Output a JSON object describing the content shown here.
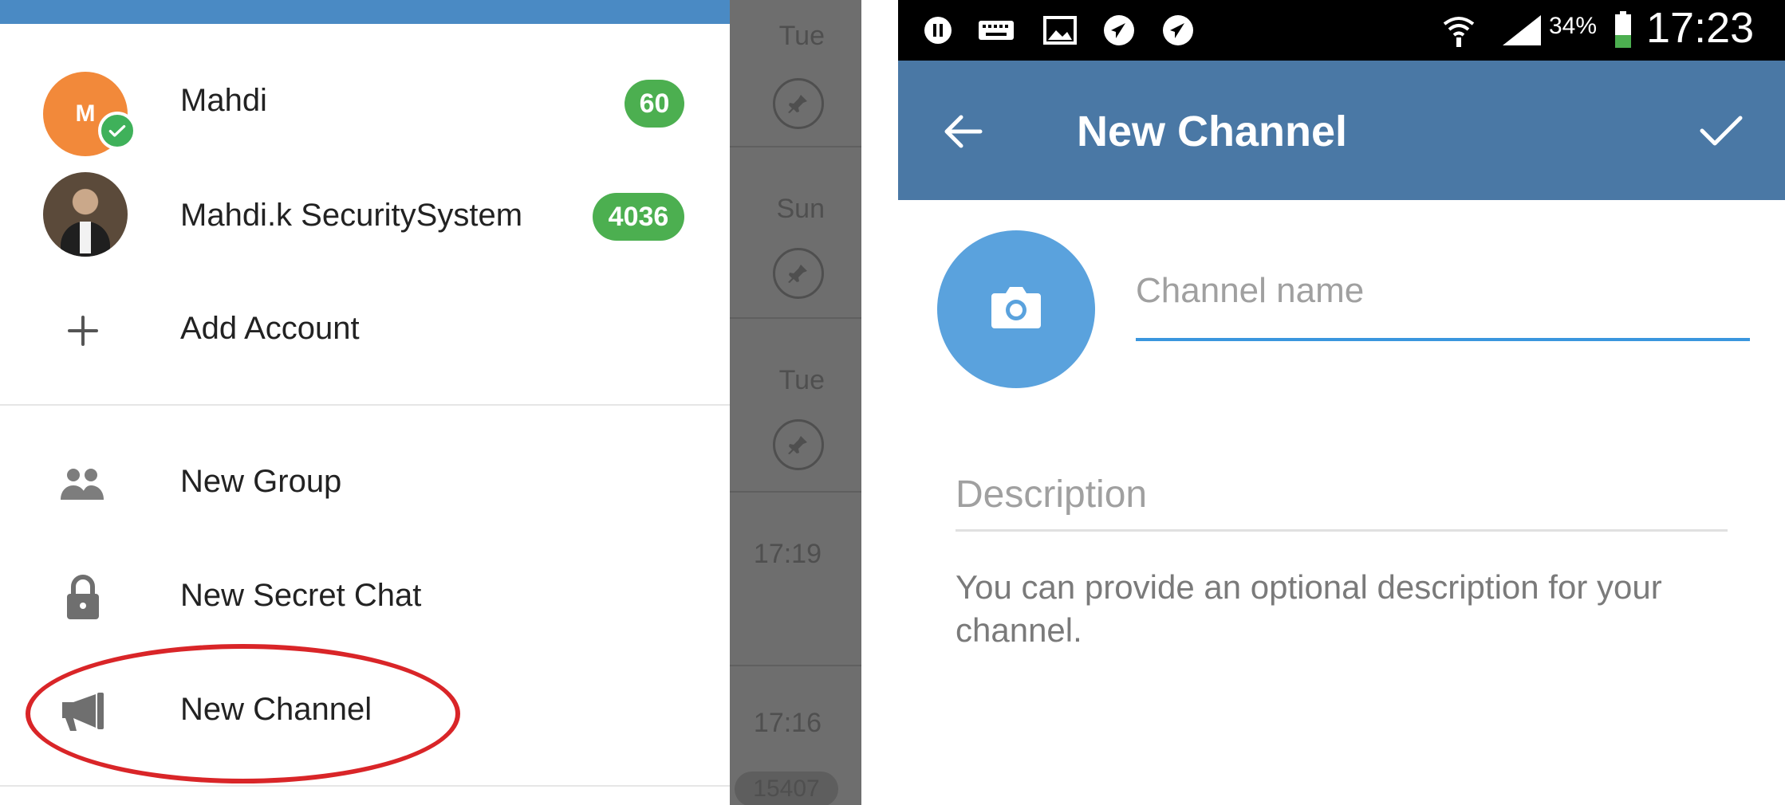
{
  "left": {
    "accounts": [
      {
        "avatar_letter": "M",
        "name": "Mahdi",
        "unread": "60",
        "verified": true
      },
      {
        "avatar_letter": "",
        "name": "Mahdi.k SecuritySystem",
        "unread": "4036"
      }
    ],
    "add_account": "Add Account",
    "menu": [
      {
        "label": "New Group",
        "icon": "group-icon"
      },
      {
        "label": "New Secret Chat",
        "icon": "lock-icon"
      },
      {
        "label": "New Channel",
        "icon": "megaphone-icon",
        "highlighted": true
      }
    ],
    "background_chats": [
      {
        "day": "Tue"
      },
      {
        "day": "Sun"
      },
      {
        "day": "Tue"
      },
      {
        "time": "17:19"
      },
      {
        "time": "17:16",
        "badge": "15407"
      }
    ]
  },
  "right": {
    "status_bar": {
      "battery": "34%",
      "time": "17:23"
    },
    "app_bar": {
      "title": "New Channel"
    },
    "channel_name_placeholder": "Channel name",
    "description_placeholder": "Description",
    "helper_text": "You can provide an optional description for your channel."
  },
  "colors": {
    "header_blue": "#4a78a5",
    "drawer_topbar": "#4a8ac4",
    "badge_green": "#4caf50",
    "accent_blue": "#3a96de",
    "photo_button": "#5aa2dd",
    "highlight_red": "#d92528"
  }
}
